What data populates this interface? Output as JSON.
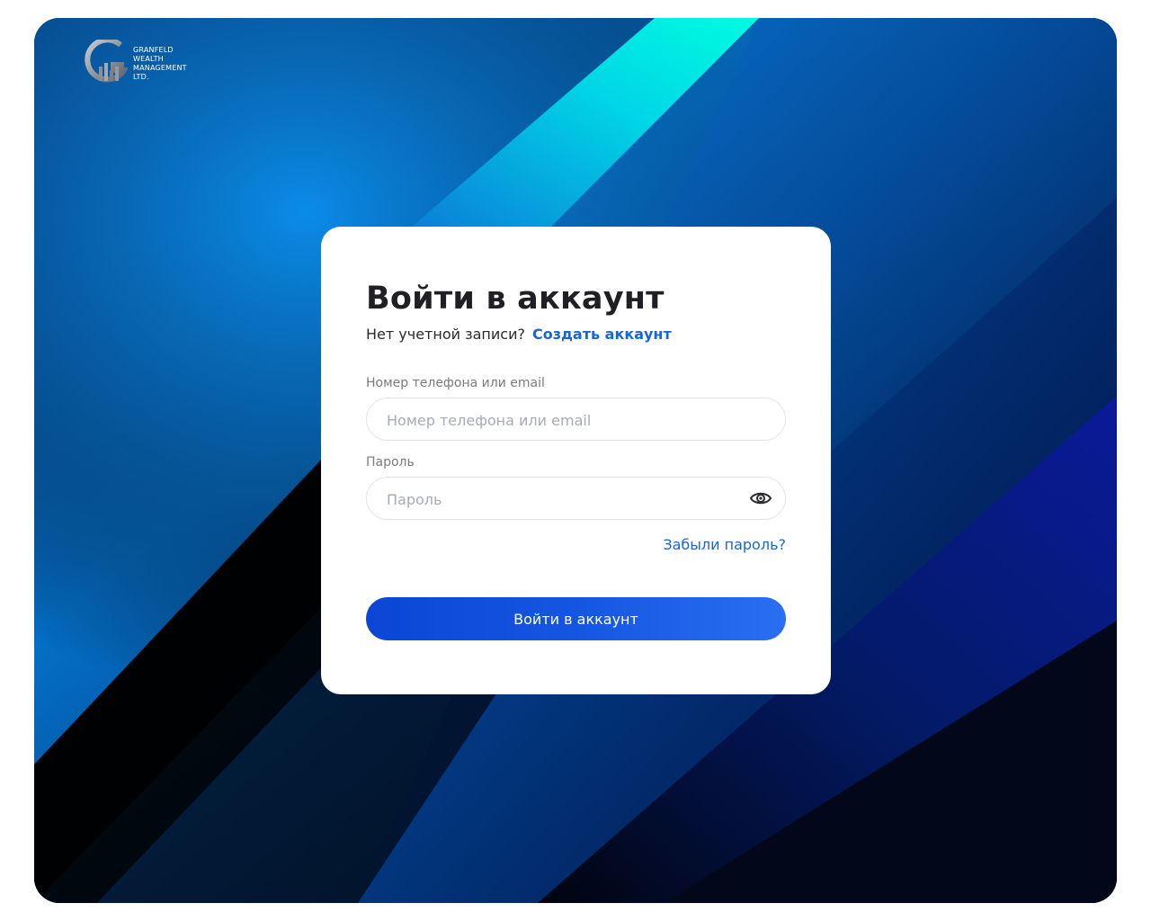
{
  "brand": {
    "lines": [
      "GRANFELD",
      "WEALTH",
      "MANAGEMENT",
      "LTD."
    ]
  },
  "login": {
    "title": "Войти в аккаунт",
    "no_account_text": "Нет учетной записи?",
    "create_account_link": "Создать аккаунт",
    "login_label": "Номер телефона или email",
    "login_placeholder": "Номер телефона или email",
    "login_value": "",
    "password_label": "Пароль",
    "password_placeholder": "Пароль",
    "password_value": "",
    "forgot_password": "Забыли пароль?",
    "submit_label": "Войти в аккаунт"
  },
  "icons": {
    "logo": "granfeld-logo-icon",
    "password_toggle": "eye-icon"
  },
  "colors": {
    "accent": "#1766d8",
    "button_start": "#0b46d6",
    "button_end": "#2a6ff2",
    "background_cyan": "#00f0e0",
    "background_blue": "#0a7fd8",
    "background_dark": "#000000"
  }
}
